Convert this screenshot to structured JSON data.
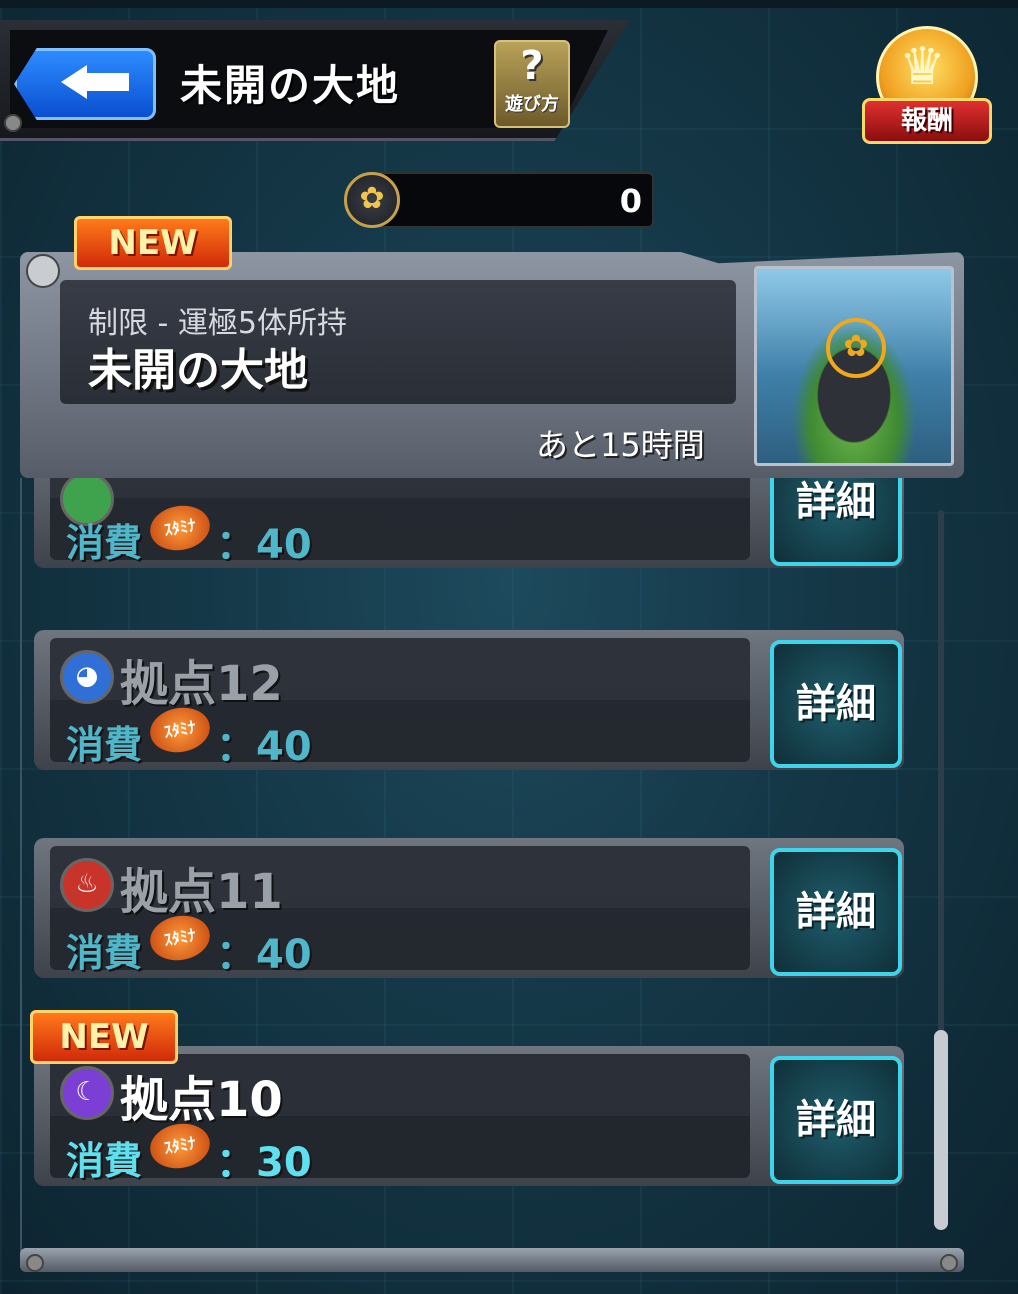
{
  "header": {
    "title": "未開の大地",
    "help_label": "遊び方",
    "help_icon": "question-icon",
    "reward_label": "報酬"
  },
  "counter": {
    "value": "0",
    "icon": "lotus-icon"
  },
  "featured": {
    "badge": "NEW",
    "subtitle": "制限 - 運極5体所持",
    "title": "未開の大地",
    "time_left": "あと15時間"
  },
  "list": {
    "detail_label": "詳細",
    "cost_label": "消費",
    "stamina_label": "ｽﾀﾐﾅ",
    "items": [
      {
        "name": "",
        "cost": "：40",
        "attr": "wood-icon",
        "color": "#3fa34d"
      },
      {
        "name": "拠点12",
        "cost": "：40",
        "attr": "water-icon",
        "color": "#2f6fd6"
      },
      {
        "name": "拠点11",
        "cost": "：40",
        "attr": "fire-icon",
        "color": "#c9342a"
      },
      {
        "name": "拠点10",
        "cost": "：30",
        "attr": "dark-icon",
        "color": "#7b3fd6",
        "badge": "NEW"
      }
    ]
  }
}
